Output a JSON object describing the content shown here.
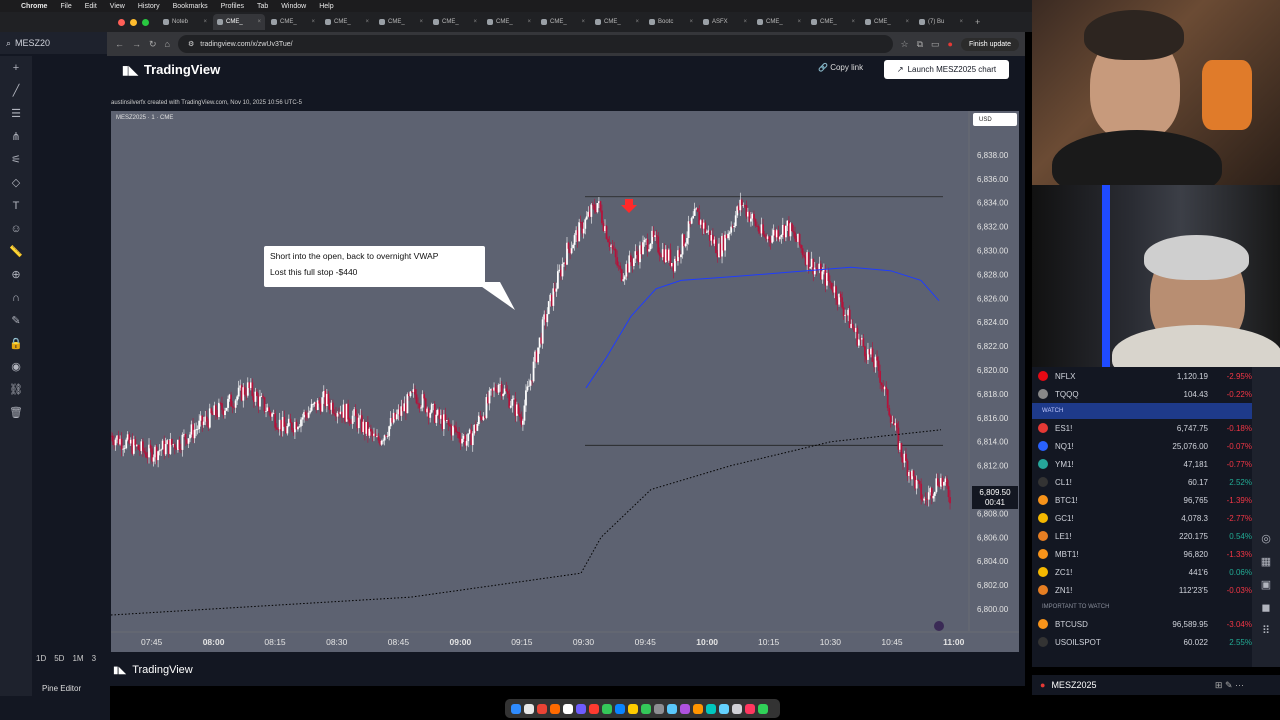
{
  "menubar": {
    "items": [
      "Chrome",
      "File",
      "Edit",
      "View",
      "History",
      "Bookmarks",
      "Profiles",
      "Tab",
      "Window",
      "Help"
    ]
  },
  "tabs": [
    {
      "label": "Noteb"
    },
    {
      "label": "CME_"
    },
    {
      "label": "CME_"
    },
    {
      "label": "CME_"
    },
    {
      "label": "CME_"
    },
    {
      "label": "CME_"
    },
    {
      "label": "CME_"
    },
    {
      "label": "CME_"
    },
    {
      "label": "CME_"
    },
    {
      "label": "Bootc"
    },
    {
      "label": "ASFX"
    },
    {
      "label": "CME_"
    },
    {
      "label": "CME_"
    },
    {
      "label": "CME_"
    },
    {
      "label": "(7) Bu"
    }
  ],
  "bg_window": {
    "symbol": "MESZ20",
    "tab_label": "MESZ2025",
    "pine_label": "Pine Editor",
    "intervals": [
      "1D",
      "5D",
      "1M",
      "3"
    ]
  },
  "browser": {
    "url": "tradingview.com/x/zwUv3Tue/",
    "finish_update": "Finish update"
  },
  "page": {
    "brand": "TradingView",
    "copy_link": "Copy link",
    "launch_button": "Launch MESZ2025 chart",
    "created_by": "austinsilverfx created with TradingView.com, Nov 10, 2025 10:56 UTC-5",
    "chart_symbol": "MESZ2025 · 1 · CME",
    "currency": "USD",
    "callout_line1": "Short into the open, back to overnight VWAP",
    "callout_line2": "Lost this full stop -$440",
    "last_price": "6,809.50",
    "countdown": "00:41",
    "footer_brand": "TradingView"
  },
  "chart_data": {
    "type": "candlestick",
    "y_axis_labels": [
      "6,838.00",
      "6,836.00",
      "6,834.00",
      "6,832.00",
      "6,830.00",
      "6,828.00",
      "6,826.00",
      "6,824.00",
      "6,822.00",
      "6,820.00",
      "6,818.00",
      "6,816.00",
      "6,814.00",
      "6,812.00",
      "6,810.00",
      "6,808.00",
      "6,806.00",
      "6,804.00",
      "6,802.00",
      "6,800.00"
    ],
    "ylim": [
      6799,
      6840
    ],
    "x_axis_labels": [
      "07:45",
      "08:00",
      "08:15",
      "08:30",
      "08:45",
      "09:00",
      "09:15",
      "09:30",
      "09:45",
      "10:00",
      "10:15",
      "10:30",
      "10:45",
      "11:00"
    ],
    "bold_x_labels": [
      "08:00",
      "09:00",
      "10:00",
      "11:00"
    ],
    "horizontal_levels": [
      6834.5,
      6813.7
    ],
    "last_price": 6809.5,
    "series_colors": {
      "up": "#ffffff",
      "down": "#b5123a",
      "vwap_overnight": "#000000",
      "session_vwap": "#1e3cff"
    }
  },
  "watchlist": {
    "top": [
      {
        "sym": "NFLX",
        "last": "1,120.19",
        "chg": "-2.95%",
        "color": "#e50914",
        "up": false
      },
      {
        "sym": "TQQQ",
        "last": "104.43",
        "chg": "-0.22%",
        "color": "#888888",
        "up": false
      }
    ],
    "section_watch": "WATCH",
    "watch": [
      {
        "sym": "ES1!",
        "last": "6,747.75",
        "chg": "-0.18%",
        "color": "#e53935",
        "up": false
      },
      {
        "sym": "NQ1!",
        "last": "25,076.00",
        "chg": "-0.07%",
        "color": "#2962ff",
        "up": false
      },
      {
        "sym": "YM1!",
        "last": "47,181",
        "chg": "-0.77%",
        "color": "#26a69a",
        "up": false
      },
      {
        "sym": "CL1!",
        "last": "60.17",
        "chg": "2.52%",
        "color": "#333333",
        "up": true
      },
      {
        "sym": "BTC1!",
        "last": "96,765",
        "chg": "-1.39%",
        "color": "#f7931a",
        "up": false
      },
      {
        "sym": "GC1!",
        "last": "4,078.3",
        "chg": "-2.77%",
        "color": "#f5b800",
        "up": false
      },
      {
        "sym": "LE1!",
        "last": "220.175",
        "chg": "0.54%",
        "color": "#e67e22",
        "up": true
      },
      {
        "sym": "MBT1!",
        "last": "96,820",
        "chg": "-1.33%",
        "color": "#f7931a",
        "up": false
      },
      {
        "sym": "ZC1!",
        "last": "441'6",
        "chg": "0.06%",
        "color": "#f5b800",
        "up": true
      },
      {
        "sym": "ZN1!",
        "last": "112'23'5",
        "chg": "-0.03%",
        "color": "#e67e22",
        "up": false
      }
    ],
    "section_important": "IMPORTANT TO WATCH",
    "important": [
      {
        "sym": "BTCUSD",
        "last": "96,589.95",
        "chg": "-3.04%",
        "color": "#f7931a",
        "up": false
      },
      {
        "sym": "USOILSPOT",
        "last": "60.022",
        "chg": "2.55%",
        "color": "#333333",
        "up": true
      }
    ],
    "footer_symbol": "MESZ2025"
  }
}
